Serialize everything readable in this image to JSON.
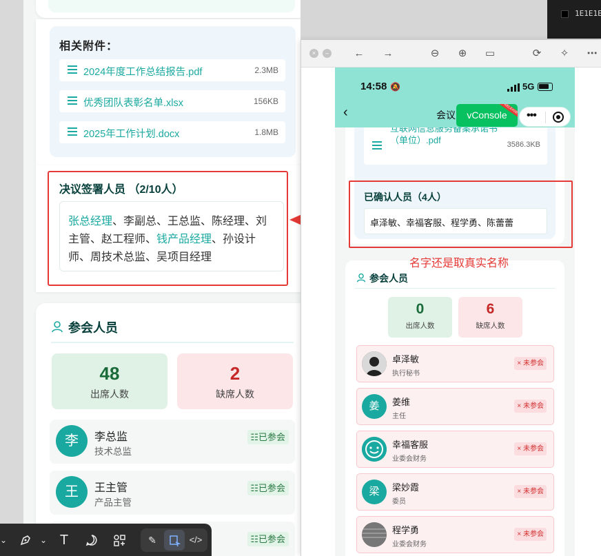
{
  "left": {
    "attachments_title": "相关附件：",
    "attachments": [
      {
        "name": "2024年度工作总结报告.pdf",
        "size": "2.3MB"
      },
      {
        "name": "优秀团队表彰名单.xlsx",
        "size": "156KB"
      },
      {
        "name": "2025年工作计划.docx",
        "size": "1.8MB"
      }
    ],
    "resolution": {
      "title": "决议签署人员 （2/10人）",
      "signed_1": "张总经理",
      "text_1": "、李副总、王总监、陈经理、刘主管、赵工程师、",
      "signed_2": "钱产品经理",
      "text_2": "、孙设计师、周技术总监、吴项目经理"
    },
    "attendees": {
      "title": "参会人员",
      "present_count": "48",
      "present_label": "出席人数",
      "absent_count": "2",
      "absent_label": "缺席人数",
      "people": [
        {
          "avatar": "李",
          "name": "李总监",
          "role": "技术总监",
          "status": "已参会"
        },
        {
          "avatar": "王",
          "name": "王主管",
          "role": "产品主管",
          "status": "已参会"
        },
        {
          "status": "已参会"
        }
      ]
    }
  },
  "dark_strip": {
    "color_hex": "1E1E1E"
  },
  "phone": {
    "status": {
      "time": "14:58",
      "network": "5G"
    },
    "nav": {
      "title": "会议",
      "vconsole": "vConsole",
      "vconsole_ribbon": "RELEASE"
    },
    "attachment": {
      "name_line_1": "互联网信息服务备案承诺书",
      "name_line_2": "（单位）.pdf",
      "size": "3586.3KB"
    },
    "confirmed": {
      "title": "已确认人员（4人）",
      "names": "卓泽敏、幸福客服、程学勇、陈蕾蕾"
    },
    "note": "名字还是取真实名称",
    "attendees": {
      "title": "参会人员",
      "present_count": "0",
      "present_label": "出席人数",
      "absent_count": "6",
      "absent_label": "缺席人数",
      "people": [
        {
          "avatar": "",
          "name": "卓泽敏",
          "role": "执行秘书",
          "status": "× 未参会"
        },
        {
          "avatar": "姜",
          "name": "姜维",
          "role": "主任",
          "status": "× 未参会"
        },
        {
          "avatar": "",
          "name": "幸福客服",
          "role": "业委会财务",
          "status": "× 未参会"
        },
        {
          "avatar": "梁",
          "name": "梁妙霞",
          "role": "委员",
          "status": "× 未参会"
        },
        {
          "avatar": "",
          "name": "程学勇",
          "role": "业委会财务",
          "status": "× 未参会"
        }
      ]
    }
  },
  "colors": {
    "accent": "#1aa9a0",
    "annotation_red": "#e53935",
    "header_teal": "#8fe3d4"
  }
}
